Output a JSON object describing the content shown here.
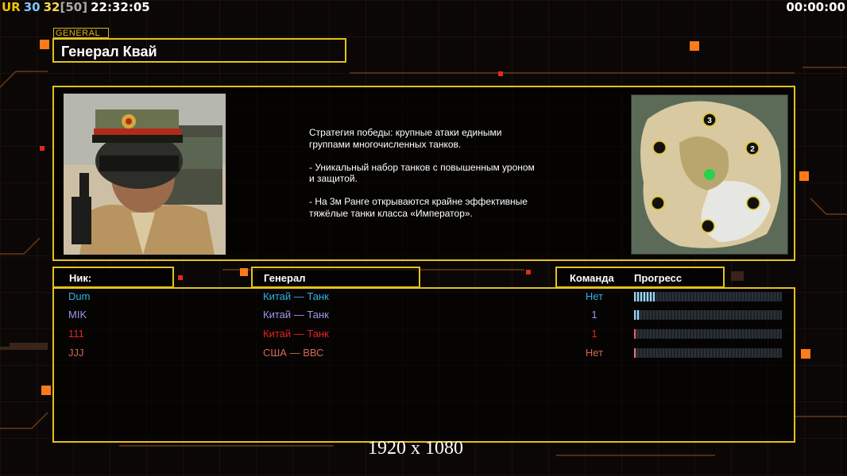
{
  "hud": {
    "ur_label": "UR",
    "counter1": "30",
    "counter2": "32",
    "counter3": "[50]",
    "clock": "22:32:05",
    "timer": "00:00:00"
  },
  "general": {
    "tag": "GENERAL",
    "name": "Генерал Квай",
    "description": "Стратегия победы: крупные атаки едиными\n группами многочисленных танков.\n\n- Уникальный набор танков с повышенным уроном\n и защитой.\n\n- На 3м Ранге открываются крайне эффективные\n тяжёлые танки класса «Император»."
  },
  "map": {
    "slots": [
      "3",
      "2"
    ]
  },
  "table": {
    "headers": {
      "nick": "Ник:",
      "general": "Генерал",
      "team": "Команда",
      "progress": "Прогресс"
    },
    "rows": [
      {
        "nick": "Dum",
        "general": "Китай — Танк",
        "team": "Нет",
        "progress": 0.14,
        "color": "#2ab4e6"
      },
      {
        "nick": "MIK",
        "general": "Китай — Танк",
        "team": "1",
        "progress": 0.04,
        "color": "#9a9ae8"
      },
      {
        "nick": "111",
        "general": "Китай — Танк",
        "team": "1",
        "progress": 0.02,
        "color": "#e52222"
      },
      {
        "nick": "JJJ",
        "general": "США — ВВС",
        "team": "Нет",
        "progress": 0.02,
        "color": "#d06a52"
      }
    ]
  },
  "resolution_label": "1920 x 1080",
  "colors": {
    "frame": "#e3c21a",
    "hud_ur": "#f0c400",
    "hud_c1": "#7fc6ff",
    "hud_c2": "#ffd84a",
    "hud_c3": "#aaaaaa",
    "accent_orange": "#ff7a1a"
  }
}
